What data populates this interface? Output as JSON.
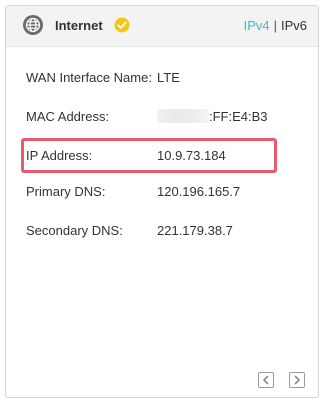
{
  "header": {
    "title": "Internet",
    "tabs": [
      {
        "label": "IPv4",
        "active": true
      },
      {
        "label": "IPv6",
        "active": false
      }
    ],
    "separator": "|"
  },
  "info_rows": [
    {
      "label": "WAN Interface Name:",
      "value": "LTE"
    },
    {
      "label": "MAC Address:",
      "value": ":FF:E4:B3"
    },
    {
      "label": "IP Address:",
      "value": "10.9.73.184"
    },
    {
      "label": "Primary DNS:",
      "value": "120.196.165.7"
    },
    {
      "label": "Secondary DNS:",
      "value": "221.179.38.7"
    }
  ],
  "colors": {
    "accent_tab": "#3bbcc8",
    "status_check": "#f5c518",
    "highlight_border": "#e85b70"
  },
  "icons": {
    "header": "globe-icon",
    "status": "check-circle-icon",
    "nav_prev": "chevron-left-icon",
    "nav_next": "chevron-right-icon"
  }
}
